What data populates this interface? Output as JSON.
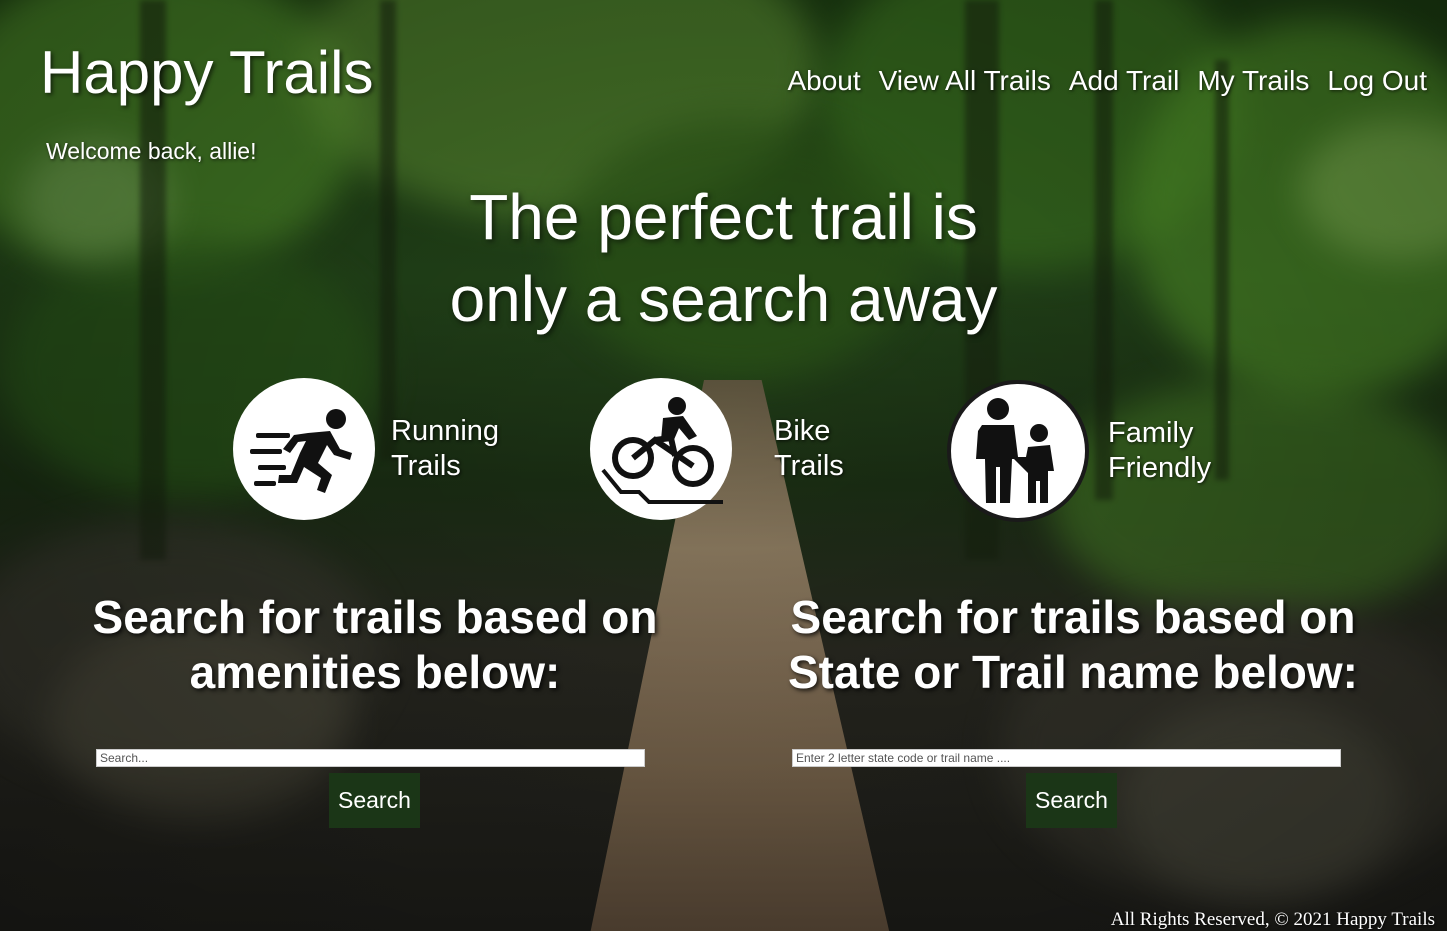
{
  "header": {
    "brand": "Happy Trails",
    "welcome": "Welcome back, allie!"
  },
  "nav": {
    "items": [
      {
        "label": "About"
      },
      {
        "label": "View All Trails"
      },
      {
        "label": "Add Trail"
      },
      {
        "label": "My Trails"
      },
      {
        "label": "Log Out"
      }
    ]
  },
  "hero": {
    "line1": "The perfect trail is",
    "line2": "only a search away"
  },
  "categories": [
    {
      "line1": "Running",
      "line2": "Trails",
      "icon": "running-icon"
    },
    {
      "line1": "Bike",
      "line2": "Trails",
      "icon": "bike-icon"
    },
    {
      "line1": "Family",
      "line2": "Friendly",
      "icon": "family-icon"
    }
  ],
  "search_amenities": {
    "heading_line1": "Search for trails based on",
    "heading_line2": "amenities below:",
    "placeholder": "Search...",
    "value": "",
    "button": "Search"
  },
  "search_state": {
    "heading_line1": "Search for trails based on",
    "heading_line2": "State or Trail name below:",
    "placeholder": "Enter 2 letter state code or trail name ....",
    "value": "",
    "button": "Search"
  },
  "footer": {
    "text": "All Rights Reserved, © 2021 Happy Trails"
  },
  "colors": {
    "button_bg": "#1b3617",
    "text": "#ffffff"
  }
}
